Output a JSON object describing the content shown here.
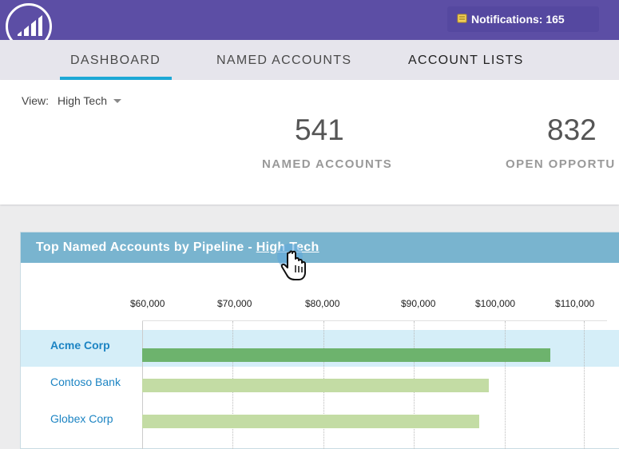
{
  "header": {
    "notifications_label": "Notifications: 165",
    "brand_color": "#5c4ea5"
  },
  "tabs": [
    {
      "label": "DASHBOARD",
      "active": true
    },
    {
      "label": "NAMED ACCOUNTS",
      "active": false
    },
    {
      "label": "ACCOUNT LISTS",
      "active": false
    }
  ],
  "view": {
    "label": "View:",
    "selected": "High Tech"
  },
  "stats": [
    {
      "value": "541",
      "label": "NAMED ACCOUNTS"
    },
    {
      "value": "832",
      "label": "OPEN OPPORTU"
    }
  ],
  "panel": {
    "title_prefix": "Top Named Accounts by Pipeline - ",
    "title_link": "High Tech"
  },
  "chart_data": {
    "type": "bar",
    "orientation": "horizontal",
    "categories": [
      "Acme Corp",
      "Contoso Bank",
      "Globex Corp"
    ],
    "values": [
      105000,
      98200,
      97200
    ],
    "x_ticks": [
      "$60,000",
      "$70,000",
      "$80,000",
      "$90,000",
      "$100,000",
      "$110,000"
    ],
    "highlighted_category": "Acme Corp",
    "colors": {
      "highlighted": "#6db36d",
      "default": "#c3dca4"
    }
  }
}
